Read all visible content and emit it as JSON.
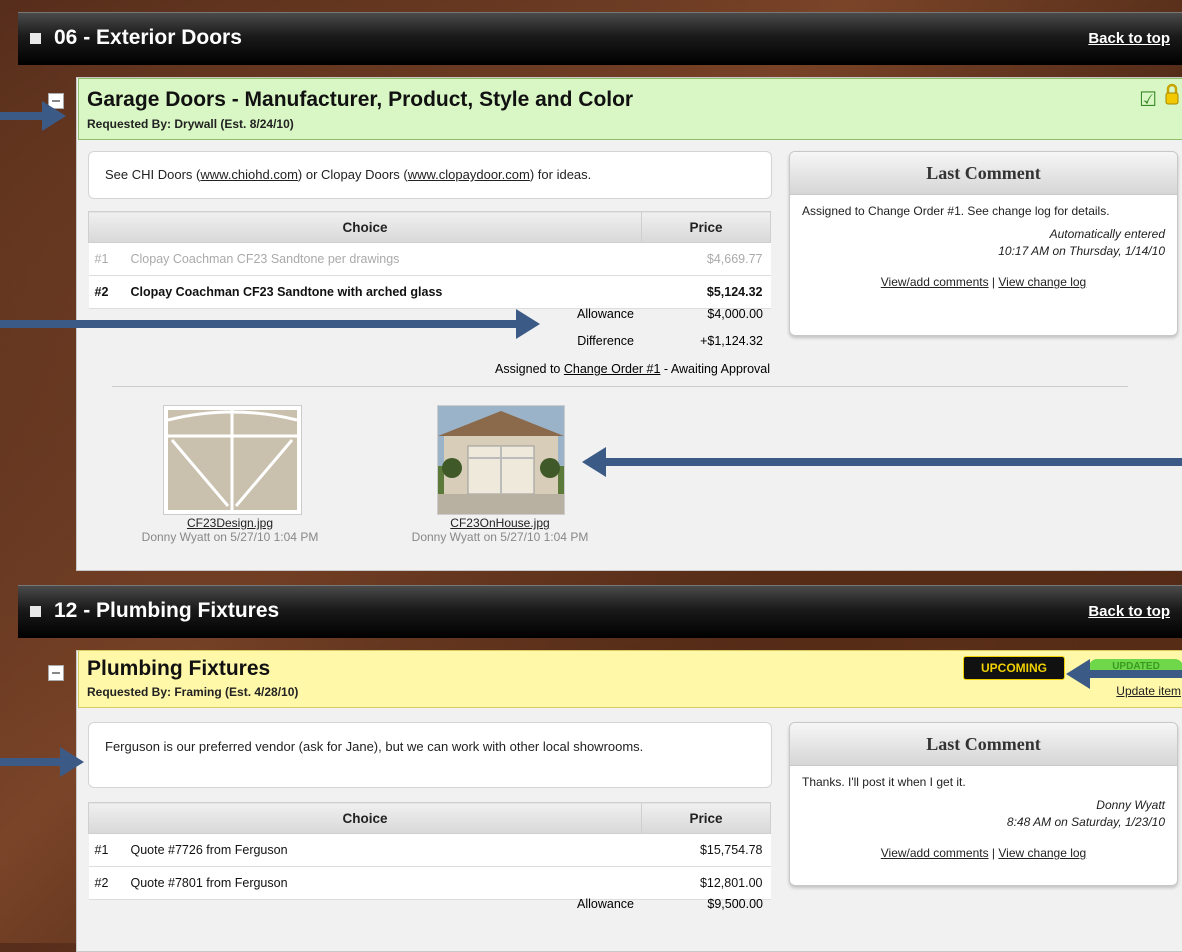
{
  "sections": [
    {
      "title": "06 - Exterior Doors",
      "back": "Back to top"
    },
    {
      "title": "12 - Plumbing Fixtures",
      "back": "Back to top"
    }
  ],
  "garage": {
    "title": "Garage Doors - Manufacturer, Product, Style and Color",
    "requested": "Requested By: Drywall (Est. 8/24/10)",
    "note_prefix": "See CHI Doors (",
    "link1": "www.chiohd.com",
    "note_mid": ") or Clopay Doors (",
    "link2": "www.clopaydoor.com",
    "note_suffix": ") for ideas.",
    "col_choice": "Choice",
    "col_price": "Price",
    "rows": [
      {
        "num": "#1",
        "choice": "Clopay Coachman CF23 Sandtone per drawings",
        "price": "$4,669.77"
      },
      {
        "num": "#2",
        "choice": "Clopay Coachman CF23 Sandtone with arched glass",
        "price": "$5,124.32"
      }
    ],
    "allowance_label": "Allowance",
    "allowance": "$4,000.00",
    "difference_label": "Difference",
    "difference": "+$1,124.32",
    "assigned_prefix": "Assigned to ",
    "assigned_link": "Change Order #1",
    "assigned_suffix": " - Awaiting Approval",
    "comment": {
      "header": "Last Comment",
      "text": "Assigned to Change Order #1. See change log for details.",
      "author": "Automatically entered",
      "time": "10:17 AM on Thursday, 1/14/10",
      "link_view": "View/add comments",
      "sep": " | ",
      "link_log": "View change log"
    },
    "files": [
      {
        "name": "CF23Design.jpg",
        "by": "Donny Wyatt on 5/27/10 1:04 PM"
      },
      {
        "name": "CF23OnHouse.jpg",
        "by": "Donny Wyatt on 5/27/10 1:04 PM"
      }
    ]
  },
  "plumbing": {
    "title": "Plumbing Fixtures",
    "requested": "Requested By: Framing (Est. 4/28/10)",
    "badge_upcoming": "UPCOMING",
    "badge_updated": "UPDATED",
    "update_link": "Update item",
    "note": "Ferguson is our preferred vendor (ask for Jane), but we can work with other local showrooms.",
    "col_choice": "Choice",
    "col_price": "Price",
    "rows": [
      {
        "num": "#1",
        "choice": "Quote #7726 from Ferguson",
        "price": "$15,754.78"
      },
      {
        "num": "#2",
        "choice": "Quote #7801 from Ferguson",
        "price": "$12,801.00"
      }
    ],
    "allowance_label": "Allowance",
    "allowance": "$9,500.00",
    "comment": {
      "header": "Last Comment",
      "text": "Thanks. I'll post it when I get it.",
      "author": "Donny Wyatt",
      "time": "8:48 AM on Saturday, 1/23/10",
      "link_view": "View/add comments",
      "sep": " | ",
      "link_log": "View change log"
    }
  },
  "colors": {
    "header_bg": "#000000",
    "approved_bg": "#d9f7c4",
    "pending_bg": "#fff8a8",
    "arrow": "#3c5a86"
  }
}
